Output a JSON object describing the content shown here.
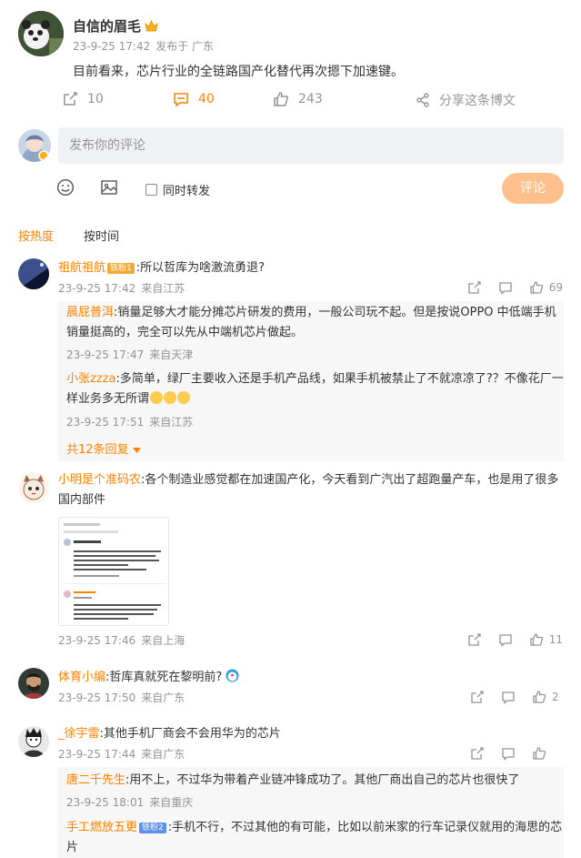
{
  "post": {
    "author": "自信的眉毛",
    "time": "23-9-25 17:42",
    "location": "发布于 广东",
    "text": "目前看来，芯片行业的全链路国产化替代再次摁下加速键。"
  },
  "actions": {
    "repost_count": "10",
    "comment_count": "40",
    "like_count": "243",
    "share_label": "分享这条博文"
  },
  "composer": {
    "placeholder": "发布你的评论",
    "repost_label": "同时转发",
    "submit_label": "评论"
  },
  "sort": {
    "hot": "按热度",
    "time": "按时间"
  },
  "comments": [
    {
      "user": "祖航祖航",
      "badge": "铁粉1",
      "text": ":所以哲库为啥激流勇退?",
      "time": "23-9-25 17:42",
      "location": "来自江苏",
      "likes": "69",
      "replies": [
        {
          "user": "晨屁普洱",
          "text": ":销量足够大才能分摊芯片研发的费用，一般公司玩不起。但是按说OPPO 中低端手机销量挺高的，完全可以先从中端机芯片做起。",
          "time": "23-9-25 17:47",
          "location": "来自天津"
        },
        {
          "user": "小张zzza",
          "text": ":多简单，绿厂主要收入还是手机产品线，如果手机被禁止了不就凉凉了?？不像花厂一样业务多无所谓",
          "time": "23-9-25 17:51",
          "location": "来自江苏"
        }
      ],
      "more": "共12条回复"
    },
    {
      "user": "小明是个准码农",
      "text": ":各个制造业感觉都在加速国产化，今天看到广汽出了超跑量产车，也是用了很多国内部件",
      "time": "23-9-25 17:46",
      "location": "来自上海",
      "likes": "11"
    },
    {
      "user": "体育小编",
      "text": ":哲库真就死在黎明前?",
      "time": "23-9-25 17:50",
      "location": "来自广东",
      "likes": "2"
    },
    {
      "user": "_徐宇雷",
      "text": ":其他手机厂商会不会用华为的芯片",
      "time": "23-9-25 17:44",
      "location": "来自广东",
      "likes": "",
      "replies": [
        {
          "user": "唐二千先生",
          "text": ":用不上，不过华为带着产业链冲锋成功了。其他厂商出自己的芯片也很快了",
          "time": "23-9-25 18:01",
          "location": "来自重庆"
        },
        {
          "user": "手工燃放五更",
          "badge": "铁粉2",
          "text": ":手机不行，不过其他的有可能，比如以前米家的行车记录仪就用的海思的芯片"
        }
      ]
    }
  ],
  "colors": {
    "accent": "#ff8200",
    "meta": "#939393",
    "reply_bg": "#f7f7f7",
    "button": "#ffc08d"
  }
}
